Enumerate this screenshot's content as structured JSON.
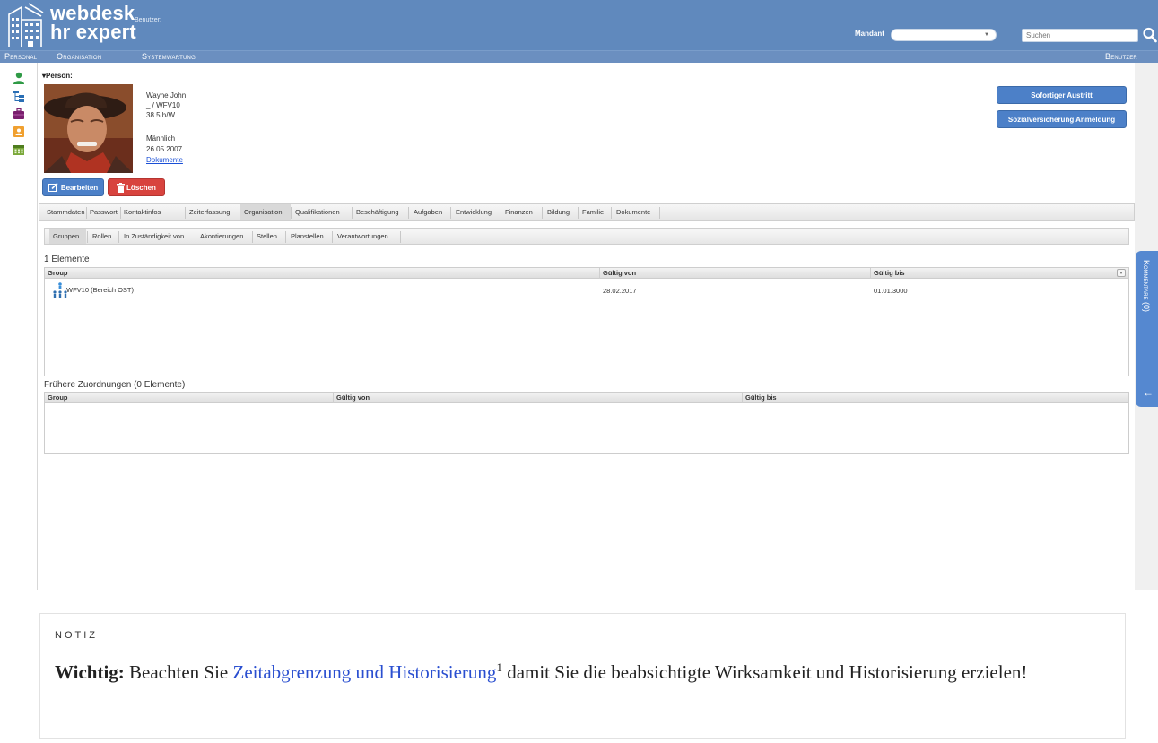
{
  "header": {
    "app_name_line1": "webdesk",
    "app_name_line2": "hr expert",
    "user_label": "Benutzer:",
    "mandant_label": "Mandant",
    "mandant_value": "",
    "search_placeholder": "Suchen"
  },
  "menu": {
    "items": [
      "Personal",
      "Organisation",
      "Systemwartung"
    ],
    "right_item": "Benutzer"
  },
  "side_icons": [
    "person-icon",
    "org-tree-icon",
    "briefcase-icon",
    "contact-card-icon",
    "calendar-icon"
  ],
  "person": {
    "section_label": "Person:",
    "name": "Wayne John",
    "id_line": "_ / WFV10",
    "hours": "38.5 h/W",
    "gender": "Männlich",
    "date": "26.05.2007",
    "documents_link": "Dokumente"
  },
  "actions": {
    "edit": "Bearbeiten",
    "delete": "Löschen",
    "exit": "Sofortiger Austritt",
    "social_insurance": "Sozialversicherung Anmeldung"
  },
  "tabs": [
    "Stammdaten",
    "Passwort",
    "Kontaktinfos",
    "Zeiterfassung",
    "Organisation",
    "Qualifikationen",
    "Beschäftigung",
    "Aufgaben",
    "Entwicklung",
    "Finanzen",
    "Bildung",
    "Familie",
    "Dokumente"
  ],
  "active_tab": "Organisation",
  "subtabs": [
    "Gruppen",
    "Rollen",
    "In Zuständigkeit von",
    "Akontierungen",
    "Stellen",
    "Planstellen",
    "Verantwortungen"
  ],
  "active_subtab": "Gruppen",
  "current": {
    "count_label": "1 Elemente",
    "columns": [
      "Group",
      "Gültig von",
      "Gültig bis"
    ],
    "rows": [
      {
        "group": "WFV10 (Bereich OST)",
        "from": "28.02.2017",
        "to": "01.01.3000"
      }
    ]
  },
  "previous": {
    "count_label": "Frühere Zuordnungen (0 Elemente)",
    "columns": [
      "Group",
      "Gültig von",
      "Gültig bis"
    ]
  },
  "comments_tab": "Kommentare (0)",
  "note": {
    "label": "NOTIZ",
    "bold": "Wichtig:",
    "pre": "Beachten Sie",
    "link": "Zeitabgrenzung und Historisierung",
    "sup": "1",
    "post": "damit Sie die beabsichtigte Wirksamkeit und Historisierung erzielen!"
  },
  "colors": {
    "header_blue": "#6089bd",
    "button_blue": "#4c80c8",
    "button_red": "#d8433e",
    "link_blue": "#1a4fd6"
  }
}
